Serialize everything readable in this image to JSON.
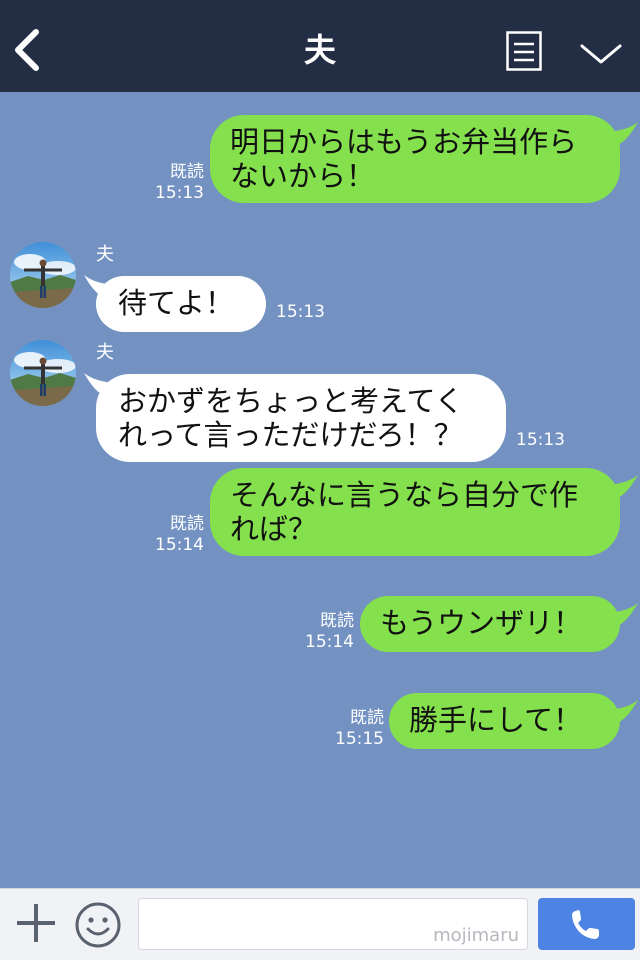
{
  "header": {
    "title": "夫"
  },
  "messages": [
    {
      "side": "out",
      "lines": [
        "明日からはもうお弁当作ら",
        "ないから！"
      ],
      "read": "既読",
      "time": "15:13"
    },
    {
      "side": "in",
      "sender": "夫",
      "lines": [
        "待てよ！"
      ],
      "time": "15:13"
    },
    {
      "side": "in",
      "sender": "夫",
      "lines": [
        "おかずをちょっと考えてく",
        "れって言っただけだろ！？"
      ],
      "time": "15:13"
    },
    {
      "side": "out",
      "lines": [
        "そんなに言うなら自分で作",
        "れば？"
      ],
      "read": "既読",
      "time": "15:14"
    },
    {
      "side": "out",
      "lines": [
        "もうウンザリ！"
      ],
      "read": "既読",
      "time": "15:14"
    },
    {
      "side": "out",
      "lines": [
        "勝手にして！"
      ],
      "read": "既読",
      "time": "15:15"
    }
  ],
  "input": {
    "watermark": "mojimaru"
  },
  "colors": {
    "header": "#232d44",
    "chat_bg": "#7392c2",
    "out_bubble": "#84e04c",
    "in_bubble": "#ffffff",
    "call_button": "#4d84e4"
  },
  "icons": {
    "back": "chevron-left-icon",
    "notes": "notes-icon",
    "menu": "chevron-down-icon",
    "plus": "plus-icon",
    "emoji": "smiley-icon",
    "call": "phone-icon"
  }
}
